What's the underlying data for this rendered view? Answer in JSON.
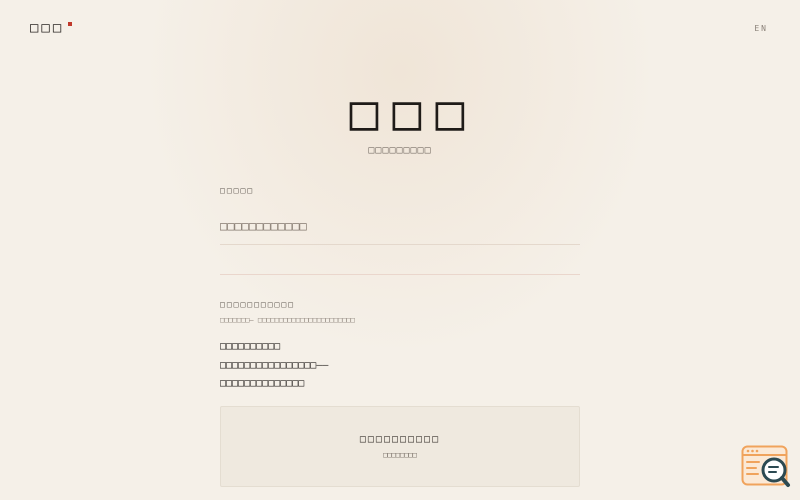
{
  "header": {
    "logo_text": "□□□",
    "lang_label": "EN"
  },
  "hero": {
    "title": "□□□",
    "subtitle": "□□□□□□□□□"
  },
  "form": {
    "name_label": "□□□□□",
    "name_placeholder": "□□□□□□□□□□□□",
    "message_label": "□□□□□□□□□□□",
    "message_hint": "□□□□□□□— □□□□□□□□□□□□□□□□□□□□□□□",
    "poem_lines": [
      "□□□□□□□□□□",
      "□□□□□□□□□□□□□□□□——",
      "□□□□□□□□□□□□□□"
    ],
    "submit_label": "□□□□□□□□□□",
    "submit_sublabel": "□□□□□□□□"
  },
  "colors": {
    "background": "#f5f0e8",
    "accent_red": "#c0392b",
    "widget_orange": "#f0a35c",
    "widget_teal": "#2c4a52"
  },
  "icons": {
    "floating_widget": "search-document-icon"
  }
}
